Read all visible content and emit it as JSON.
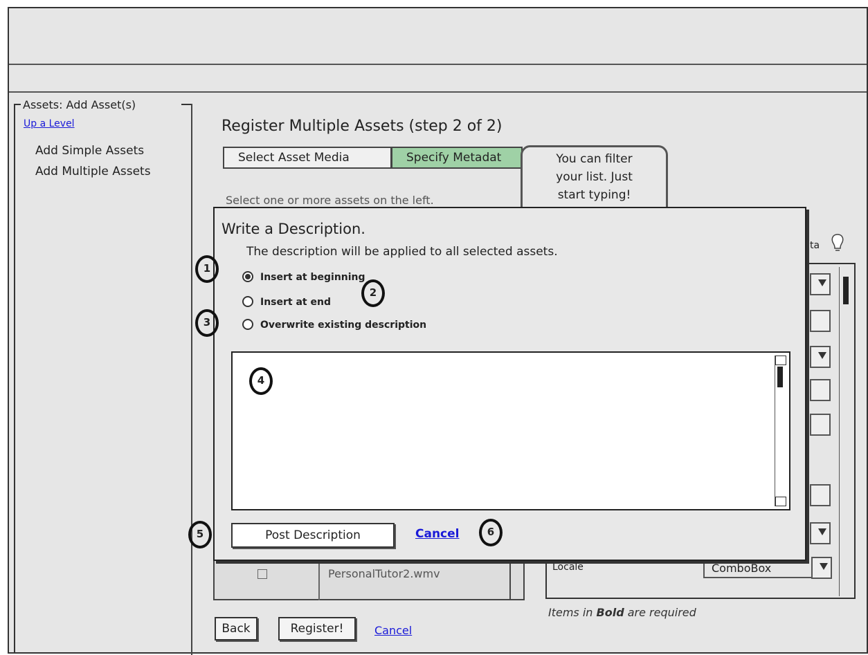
{
  "page": {
    "section_title": "Assets: Add Asset(s)",
    "up_level": "Up a Level",
    "nav_items": [
      "Add Simple Assets",
      "Add Multiple Assets"
    ],
    "main_title": "Register Multiple Assets (step 2 of 2)",
    "tabs": [
      "Select Asset Media",
      "Specify Metadat"
    ],
    "select_hint": "Select one or more assets on the left.",
    "tooltip_lines": [
      "You can filter",
      "your list.  Just",
      "start typing!"
    ],
    "right_label_fragment": "ta",
    "locale_label": "Locale",
    "combo_value": "ComboBox",
    "file_name": "PersonalTutor2.wmv",
    "required_note_prefix": "Items in ",
    "required_note_bold": "Bold",
    "required_note_suffix": " are required",
    "back_label": "Back",
    "register_label": "Register!",
    "cancel_label": "Cancel"
  },
  "dialog": {
    "title": "Write a Description.",
    "subtitle": "The description will be applied to all selected assets.",
    "options": [
      "Insert at beginning",
      "Insert at end",
      "Overwrite existing description"
    ],
    "selected_option": 0,
    "post_label": "Post Description",
    "cancel_label": "Cancel",
    "markers": [
      "1",
      "2",
      "3",
      "4",
      "5",
      "6"
    ]
  }
}
